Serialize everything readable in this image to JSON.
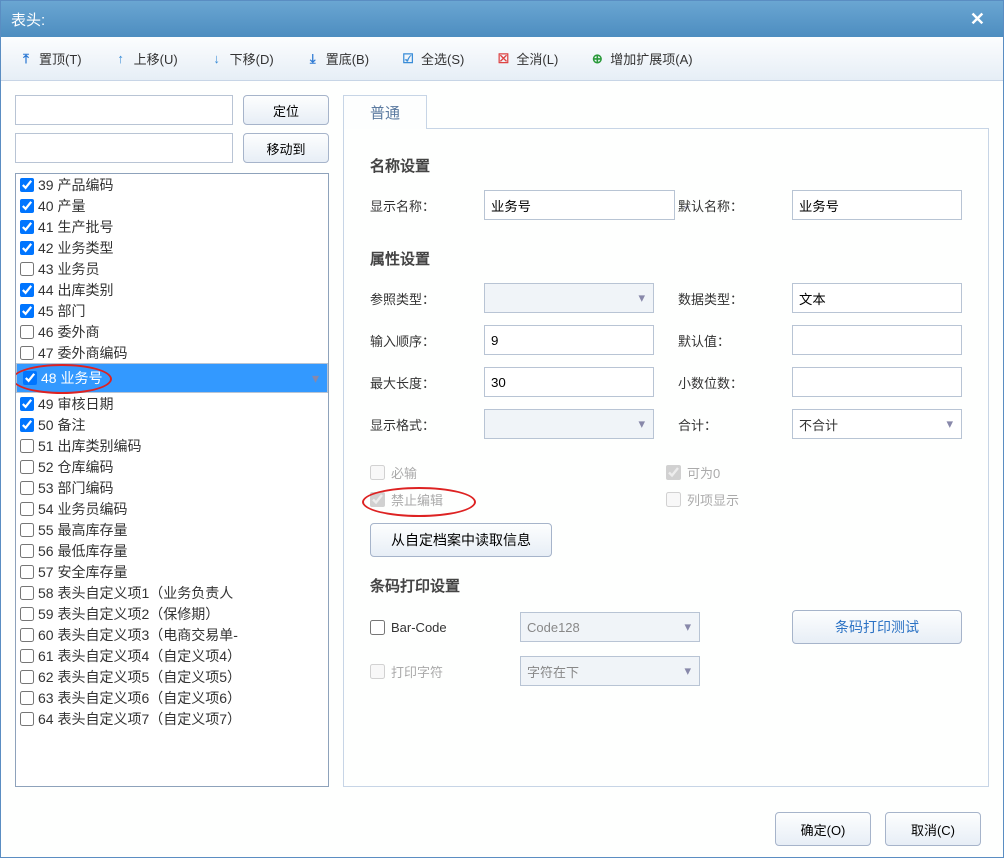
{
  "title": "表头:",
  "toolbar": {
    "top": "置顶(T)",
    "up": "上移(U)",
    "down": "下移(D)",
    "bottom": "置底(B)",
    "all": "全选(S)",
    "none": "全消(L)",
    "add": "增加扩展项(A)"
  },
  "locate_btn": "定位",
  "moveto_btn": "移动到",
  "locate_value": "",
  "moveto_value": "",
  "items": [
    {
      "n": "39",
      "label": "产品编码",
      "chk": true,
      "sel": false
    },
    {
      "n": "40",
      "label": "产量",
      "chk": true,
      "sel": false
    },
    {
      "n": "41",
      "label": "生产批号",
      "chk": true,
      "sel": false
    },
    {
      "n": "42",
      "label": "业务类型",
      "chk": true,
      "sel": false
    },
    {
      "n": "43",
      "label": "业务员",
      "chk": false,
      "sel": false
    },
    {
      "n": "44",
      "label": "出库类别",
      "chk": true,
      "sel": false
    },
    {
      "n": "45",
      "label": "部门",
      "chk": true,
      "sel": false
    },
    {
      "n": "46",
      "label": "委外商",
      "chk": false,
      "sel": false
    },
    {
      "n": "47",
      "label": "委外商编码",
      "chk": false,
      "sel": false
    },
    {
      "n": "48",
      "label": "业务号",
      "chk": true,
      "sel": true
    },
    {
      "n": "49",
      "label": "审核日期",
      "chk": true,
      "sel": false
    },
    {
      "n": "50",
      "label": "备注",
      "chk": true,
      "sel": false
    },
    {
      "n": "51",
      "label": "出库类别编码",
      "chk": false,
      "sel": false
    },
    {
      "n": "52",
      "label": "仓库编码",
      "chk": false,
      "sel": false
    },
    {
      "n": "53",
      "label": "部门编码",
      "chk": false,
      "sel": false
    },
    {
      "n": "54",
      "label": "业务员编码",
      "chk": false,
      "sel": false
    },
    {
      "n": "55",
      "label": "最高库存量",
      "chk": false,
      "sel": false
    },
    {
      "n": "56",
      "label": "最低库存量",
      "chk": false,
      "sel": false
    },
    {
      "n": "57",
      "label": "安全库存量",
      "chk": false,
      "sel": false
    },
    {
      "n": "58",
      "label": "表头自定义项1（业务负责人",
      "chk": false,
      "sel": false
    },
    {
      "n": "59",
      "label": "表头自定义项2（保修期）",
      "chk": false,
      "sel": false
    },
    {
      "n": "60",
      "label": "表头自定义项3（电商交易单-",
      "chk": false,
      "sel": false
    },
    {
      "n": "61",
      "label": "表头自定义项4（自定义项4）",
      "chk": false,
      "sel": false
    },
    {
      "n": "62",
      "label": "表头自定义项5（自定义项5）",
      "chk": false,
      "sel": false
    },
    {
      "n": "63",
      "label": "表头自定义项6（自定义项6）",
      "chk": false,
      "sel": false
    },
    {
      "n": "64",
      "label": "表头自定义项7（自定义项7）",
      "chk": false,
      "sel": false
    }
  ],
  "tab_normal": "普通",
  "sec_name": "名称设置",
  "lbl_dispname": "显示名称：",
  "val_dispname": "业务号",
  "lbl_defname": "默认名称：",
  "val_defname": "业务号",
  "sec_attr": "属性设置",
  "lbl_reftype": "参照类型：",
  "val_reftype": "",
  "lbl_datatype": "数据类型：",
  "val_datatype": "文本",
  "lbl_order": "输入顺序：",
  "val_order": "9",
  "lbl_default": "默认值：",
  "val_default": "",
  "lbl_maxlen": "最大长度：",
  "val_maxlen": "30",
  "lbl_dec": "小数位数：",
  "val_dec": "",
  "lbl_fmt": "显示格式：",
  "val_fmt": "",
  "lbl_sum": "合计：",
  "val_sum": "不合计",
  "chk_required": "必输",
  "chk_zero": "可为0",
  "chk_noedit": "禁止编辑",
  "chk_column": "列项显示",
  "btn_read": "从自定档案中读取信息",
  "sec_barcode": "条码打印设置",
  "lbl_barcode": "Bar-Code",
  "val_barcode": "Code128",
  "lbl_printchar": "打印字符",
  "val_printchar": "字符在下",
  "btn_print": "条码打印测试",
  "btn_ok": "确定(O)",
  "btn_cancel": "取消(C)"
}
